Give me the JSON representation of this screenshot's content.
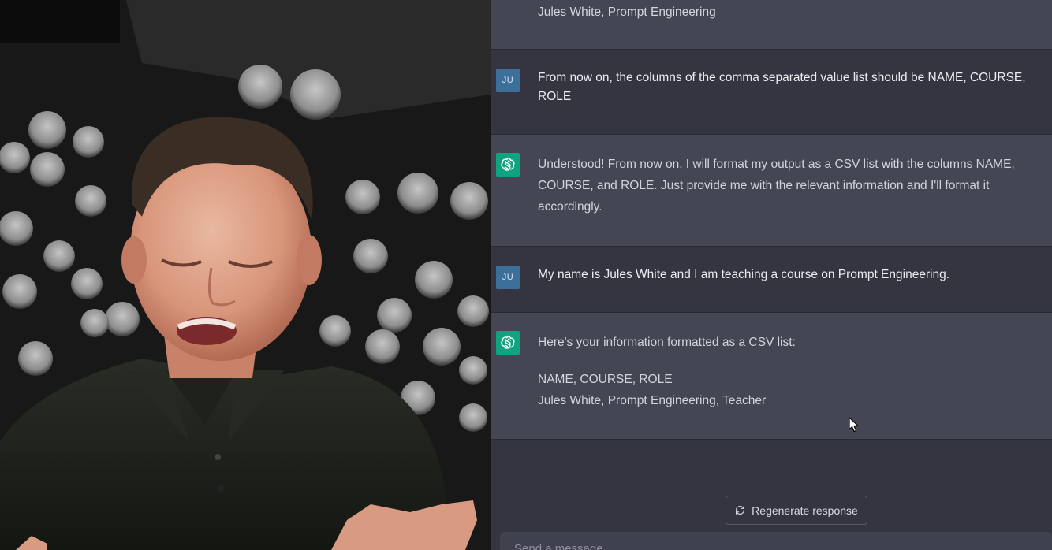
{
  "chat": {
    "messages": [
      {
        "role": "bot",
        "avatar": "openai-logo",
        "lines": [
          "Jules White, Prompt Engineering"
        ]
      },
      {
        "role": "user",
        "avatar": "JU",
        "lines": [
          "From now on, the columns of the comma separated value list should be NAME, COURSE,",
          "ROLE"
        ]
      },
      {
        "role": "bot",
        "avatar": "openai-logo",
        "lines": [
          "Understood! From now on, I will format my output as a CSV list with the columns NAME,",
          "COURSE, and ROLE. Just provide me with the relevant information and I'll format it",
          "accordingly."
        ]
      },
      {
        "role": "user",
        "avatar": "JU",
        "lines": [
          "My name is Jules White and I am teaching a course on Prompt Engineering."
        ]
      },
      {
        "role": "bot",
        "avatar": "openai-logo",
        "lines": [
          "Here's your information formatted as a CSV list:",
          "",
          "NAME, COURSE, ROLE",
          "Jules White, Prompt Engineering, Teacher"
        ]
      }
    ],
    "regenerate_label": "Regenerate response",
    "input_placeholder": "Send a message..."
  },
  "icons": {
    "bot_avatar": "openai-logo-icon",
    "regenerate": "refresh-icon",
    "cursor": "mouse-pointer-icon"
  },
  "colors": {
    "chat_bg": "#343541",
    "bot_row_bg": "#444654",
    "user_avatar_bg": "#3c6f9a",
    "bot_avatar_bg": "#10a37f"
  }
}
